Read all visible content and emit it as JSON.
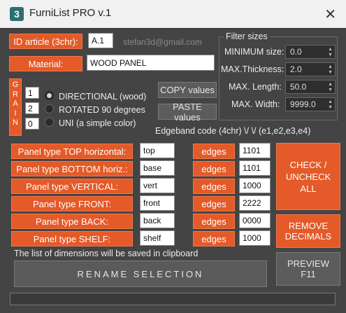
{
  "window": {
    "title": "FurniList PRO v.1",
    "icon_label": "3",
    "close_glyph": "✕"
  },
  "id_article": {
    "label": "ID article (3chr):",
    "value": "A.1"
  },
  "email": "stefan3d@gmail.com",
  "material": {
    "label": "Material:",
    "value": "WOOD PANEL"
  },
  "grain": {
    "letters": [
      "G",
      "R",
      "A",
      "I",
      "N"
    ],
    "options": [
      {
        "code": "1",
        "label": "DIRECTIONAL (wood)",
        "selected": true
      },
      {
        "code": "2",
        "label": "ROTATED 90 degrees",
        "selected": false
      },
      {
        "code": "0",
        "label": "UNI (a simple color)",
        "selected": false
      }
    ]
  },
  "buttons": {
    "copy_values": "COPY values",
    "paste_values": "PASTE values",
    "check_uncheck_line1": "CHECK /",
    "check_uncheck_line2": "UNCHECK ALL",
    "remove_decimals_line1": "REMOVE",
    "remove_decimals_line2": "DECIMALS",
    "rename_selection": "RENAME   SELECTION",
    "preview_line1": "PREVIEW",
    "preview_line2": "F11"
  },
  "filter": {
    "title": "Filter sizes",
    "rows": [
      {
        "label": "MINIMUM size:",
        "value": "0.0"
      },
      {
        "label": "MAX.Thickness:",
        "value": "2.0"
      },
      {
        "label": "MAX. Length:",
        "value": "50.0"
      },
      {
        "label": "MAX. Width:",
        "value": "9999.0"
      }
    ]
  },
  "edgeband_header": "Edgeband code (4chr) \\/ \\/  (e1,e2,e3,e4)",
  "panels": [
    {
      "label": "Panel type TOP horizontal:",
      "name": "top",
      "edges_label": "edges",
      "code": "1101"
    },
    {
      "label": "Panel type BOTTOM horiz.:",
      "name": "base",
      "edges_label": "edges",
      "code": "1101"
    },
    {
      "label": "Panel type VERTICAL:",
      "name": "vert",
      "edges_label": "edges",
      "code": "1000"
    },
    {
      "label": "Panel type FRONT:",
      "name": "front",
      "edges_label": "edges",
      "code": "2222"
    },
    {
      "label": "Panel type BACK:",
      "name": "back",
      "edges_label": "edges",
      "code": "0000"
    },
    {
      "label": "Panel type SHELF:",
      "name": "shelf",
      "edges_label": "edges",
      "code": "1000"
    }
  ],
  "clipboard_note": "The list of dimensions will be saved in clipboard",
  "colors": {
    "accent": "#e45a28",
    "background": "#444444",
    "titlebar": "#f1f1f1"
  }
}
